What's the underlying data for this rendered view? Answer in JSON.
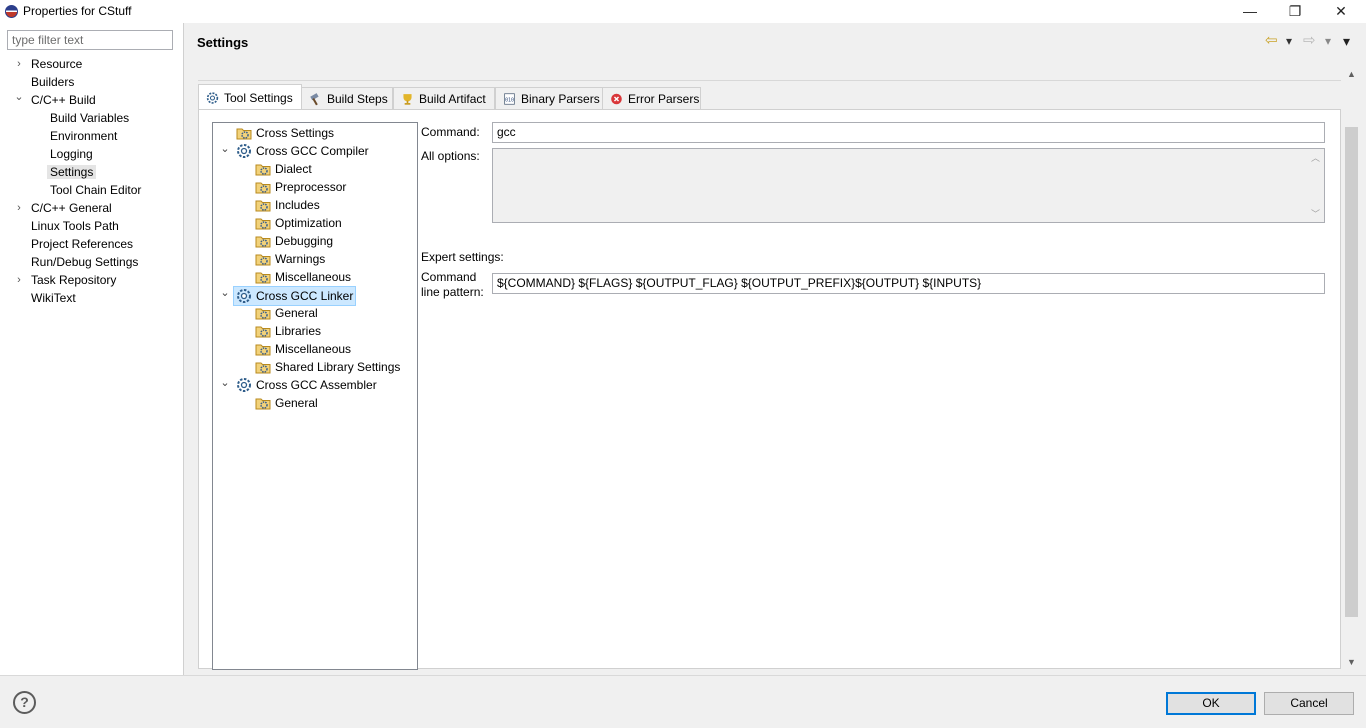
{
  "window": {
    "title": "Properties for CStuff",
    "minimize": "—",
    "restore": "❐",
    "close": "✕"
  },
  "sidebar": {
    "filter_placeholder": "type filter text",
    "items": [
      {
        "label": "Resource",
        "expander": "›"
      },
      {
        "label": "Builders"
      },
      {
        "label": "C/C++ Build",
        "expander": "⌄"
      },
      {
        "label": "Build Variables"
      },
      {
        "label": "Environment"
      },
      {
        "label": "Logging"
      },
      {
        "label": "Settings",
        "selected": true
      },
      {
        "label": "Tool Chain Editor"
      },
      {
        "label": "C/C++ General",
        "expander": "›"
      },
      {
        "label": "Linux Tools Path"
      },
      {
        "label": "Project References"
      },
      {
        "label": "Run/Debug Settings"
      },
      {
        "label": "Task Repository",
        "expander": "›"
      },
      {
        "label": "WikiText"
      }
    ]
  },
  "header": {
    "title": "Settings",
    "back_icon": "⇦",
    "back_menu": "▾",
    "forward_icon": "⇨",
    "forward_menu": "▾",
    "view_menu": "▾"
  },
  "tabs": [
    {
      "label": "Tool Settings",
      "icon": "gear-icon",
      "active": true
    },
    {
      "label": "Build Steps",
      "icon": "hammer-icon"
    },
    {
      "label": "Build Artifact",
      "icon": "trophy-icon"
    },
    {
      "label": "Binary Parsers",
      "icon": "binary-icon"
    },
    {
      "label": "Error Parsers",
      "icon": "error-icon"
    }
  ],
  "tool_tree": {
    "rows": [
      {
        "label": "Cross Settings",
        "icon": "folder-gear-icon"
      },
      {
        "label": "Cross GCC Compiler",
        "icon": "gear-icon",
        "expander": "⌄"
      },
      {
        "label": "Dialect",
        "icon": "folder-gear-icon"
      },
      {
        "label": "Preprocessor",
        "icon": "folder-gear-icon"
      },
      {
        "label": "Includes",
        "icon": "folder-gear-icon"
      },
      {
        "label": "Optimization",
        "icon": "folder-gear-icon"
      },
      {
        "label": "Debugging",
        "icon": "folder-gear-icon"
      },
      {
        "label": "Warnings",
        "icon": "folder-gear-icon"
      },
      {
        "label": "Miscellaneous",
        "icon": "folder-gear-icon"
      },
      {
        "label": "Cross GCC Linker",
        "icon": "gear-icon",
        "expander": "⌄",
        "selected": true
      },
      {
        "label": "General",
        "icon": "folder-gear-icon"
      },
      {
        "label": "Libraries",
        "icon": "folder-gear-icon"
      },
      {
        "label": "Miscellaneous",
        "icon": "folder-gear-icon"
      },
      {
        "label": "Shared Library Settings",
        "icon": "folder-gear-icon"
      },
      {
        "label": "Cross GCC Assembler",
        "icon": "gear-icon",
        "expander": "⌄"
      },
      {
        "label": "General",
        "icon": "folder-gear-icon"
      }
    ]
  },
  "form": {
    "command_label": "Command:",
    "command_value": "gcc",
    "all_options_label": "All options:",
    "all_options_value": "",
    "expert_label": "Expert settings:",
    "pattern_label_1": "Command",
    "pattern_label_2": "line pattern:",
    "pattern_value": "${COMMAND} ${FLAGS} ${OUTPUT_FLAG} ${OUTPUT_PREFIX}${OUTPUT} ${INPUTS}"
  },
  "footer": {
    "help": "?",
    "ok": "OK",
    "cancel": "Cancel"
  },
  "colors": {
    "selection": "#cce8ff",
    "default_button_border": "#0078d7"
  }
}
